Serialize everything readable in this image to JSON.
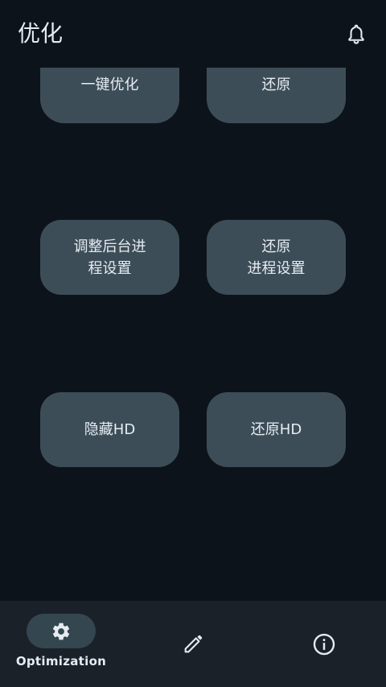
{
  "app_bar": {
    "title": "优化",
    "notification_icon": "bell-icon"
  },
  "buttons": [
    {
      "id": "one-click-optimize",
      "label": "一键优化"
    },
    {
      "id": "restore",
      "label": "还原"
    },
    {
      "id": "adjust-background",
      "label": "调整后台进\n程设置"
    },
    {
      "id": "restore-process",
      "label": "还原\n进程设置"
    },
    {
      "id": "hide-hd",
      "label": "隐藏HD"
    },
    {
      "id": "restore-hd",
      "label": "还原HD"
    }
  ],
  "bottom_nav": {
    "items": [
      {
        "label": "Optimization",
        "icon": "gear-icon",
        "selected": true
      },
      {
        "label": "",
        "icon": "pencil-icon",
        "selected": false
      },
      {
        "label": "",
        "icon": "info-icon",
        "selected": false
      }
    ]
  },
  "colors": {
    "background": "#0d131a",
    "button": "#3d4d58",
    "nav_background": "#1b2128",
    "nav_pill": "#34464f",
    "text": "#e6ebf0"
  }
}
